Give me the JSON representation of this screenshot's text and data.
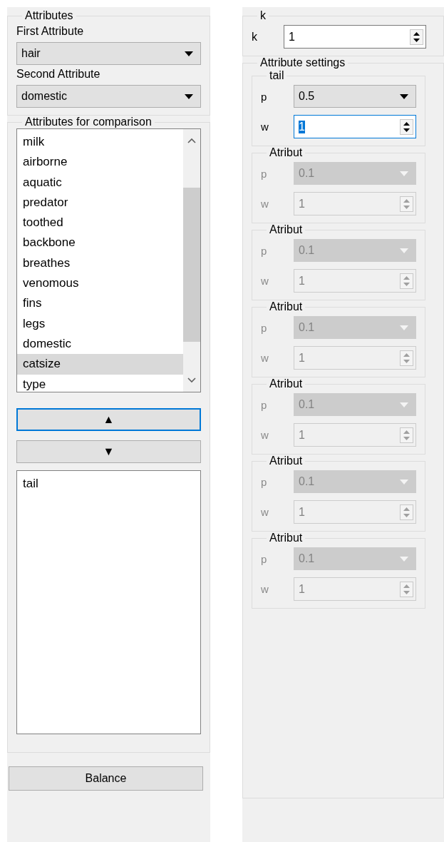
{
  "attributes": {
    "title": "Attributes",
    "first_label": "First Attribute",
    "first_value": "hair",
    "second_label": "Second Attribute",
    "second_value": "domestic"
  },
  "comparison": {
    "title": "Attributes for comparison",
    "items": [
      {
        "label": "milk",
        "selected": false
      },
      {
        "label": "airborne",
        "selected": false
      },
      {
        "label": "aquatic",
        "selected": false
      },
      {
        "label": "predator",
        "selected": false
      },
      {
        "label": "toothed",
        "selected": false
      },
      {
        "label": "backbone",
        "selected": false
      },
      {
        "label": "breathes",
        "selected": false
      },
      {
        "label": "venomous",
        "selected": false
      },
      {
        "label": "fins",
        "selected": false
      },
      {
        "label": "legs",
        "selected": false
      },
      {
        "label": "domestic",
        "selected": false
      },
      {
        "label": "catsize",
        "selected": true
      },
      {
        "label": "type",
        "selected": false
      }
    ],
    "up_button": {
      "label": "▲",
      "focused": true
    },
    "down_button": {
      "label": "▼",
      "focused": false
    },
    "chosen": [
      {
        "label": "tail"
      }
    ]
  },
  "balance_button": "Balance",
  "k_group": {
    "title": "k",
    "label": "k",
    "value": "1"
  },
  "settings": {
    "title": "Attribute settings",
    "groups": [
      {
        "title": "tail",
        "disabled": false,
        "p_label": "p",
        "p_value": "0.5",
        "w_label": "w",
        "w_value": "1",
        "w_focused": true
      },
      {
        "title": "Atribut",
        "disabled": true,
        "p_label": "p",
        "p_value": "0.1",
        "w_label": "w",
        "w_value": "1",
        "w_focused": false
      },
      {
        "title": "Atribut",
        "disabled": true,
        "p_label": "p",
        "p_value": "0.1",
        "w_label": "w",
        "w_value": "1",
        "w_focused": false
      },
      {
        "title": "Atribut",
        "disabled": true,
        "p_label": "p",
        "p_value": "0.1",
        "w_label": "w",
        "w_value": "1",
        "w_focused": false
      },
      {
        "title": "Atribut",
        "disabled": true,
        "p_label": "p",
        "p_value": "0.1",
        "w_label": "w",
        "w_value": "1",
        "w_focused": false
      },
      {
        "title": "Atribut",
        "disabled": true,
        "p_label": "p",
        "p_value": "0.1",
        "w_label": "w",
        "w_value": "1",
        "w_focused": false
      },
      {
        "title": "Atribut",
        "disabled": true,
        "p_label": "p",
        "p_value": "0.1",
        "w_label": "w",
        "w_value": "1",
        "w_focused": false
      }
    ]
  }
}
